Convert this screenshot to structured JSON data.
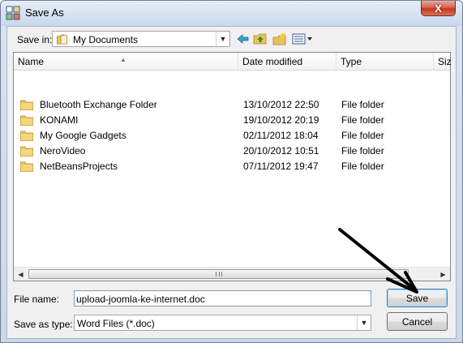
{
  "window": {
    "title": "Save As",
    "close_label": "X"
  },
  "toolbar": {
    "save_in_label": "Save in:",
    "save_in_value": "My Documents",
    "icons": [
      "back-icon",
      "up-folder-icon",
      "new-folder-icon",
      "views-menu-icon"
    ]
  },
  "file_list": {
    "columns": [
      "Name",
      "Date modified",
      "Type",
      "Size"
    ],
    "rows": [
      {
        "name": "Bluetooth Exchange Folder",
        "date": "13/10/2012 22:50",
        "type": "File folder"
      },
      {
        "name": "KONAMI",
        "date": "19/10/2012 20:19",
        "type": "File folder"
      },
      {
        "name": "My Google Gadgets",
        "date": "02/11/2012 18:04",
        "type": "File folder"
      },
      {
        "name": "NeroVideo",
        "date": "20/10/2012 10:51",
        "type": "File folder"
      },
      {
        "name": "NetBeansProjects",
        "date": "07/11/2012 19:47",
        "type": "File folder"
      }
    ]
  },
  "form": {
    "file_name_label": "File name:",
    "file_name_value": "upload-joomla-ke-internet.doc",
    "save_as_type_label": "Save as type:",
    "save_as_type_value": "Word Files (*.doc)",
    "save_label": "Save",
    "cancel_label": "Cancel"
  }
}
